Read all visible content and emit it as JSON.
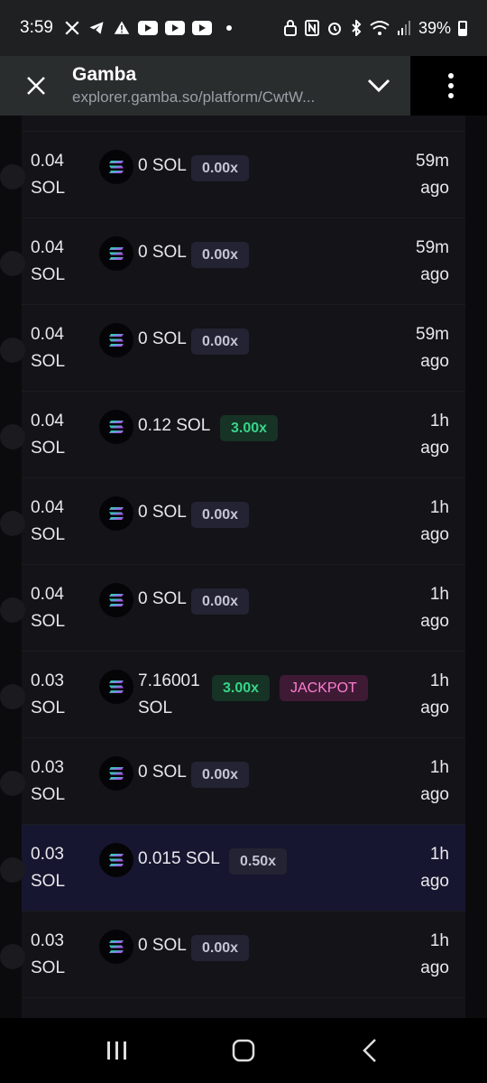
{
  "status_bar": {
    "time": "3:59",
    "battery": "39%",
    "left_icons": [
      "x-icon",
      "telegram-icon",
      "warning-icon",
      "youtube-icon",
      "youtube-icon",
      "youtube-icon"
    ],
    "right_icons": [
      "lock-icon",
      "nfc-icon",
      "alarm-icon",
      "bluetooth-icon",
      "wifi-icon",
      "signal-icon"
    ]
  },
  "header": {
    "title": "Gamba",
    "url": "explorer.gamba.so/platform/CwtW..."
  },
  "colors": {
    "win_badge": "#38d48a",
    "jackpot_badge": "#ff7fd0",
    "neutral_badge": "#c4c4d4",
    "highlight_row": "#161630"
  },
  "rows": [
    {
      "wager": "0.04",
      "wager_unit": "SOL",
      "payout": "0 SOL",
      "multiplier": "0.00x",
      "badge_type": "neutral",
      "time": "59m",
      "time_suffix": "ago"
    },
    {
      "wager": "0.04",
      "wager_unit": "SOL",
      "payout": "0 SOL",
      "multiplier": "0.00x",
      "badge_type": "neutral",
      "time": "59m",
      "time_suffix": "ago"
    },
    {
      "wager": "0.04",
      "wager_unit": "SOL",
      "payout": "0 SOL",
      "multiplier": "0.00x",
      "badge_type": "neutral",
      "time": "59m",
      "time_suffix": "ago"
    },
    {
      "wager": "0.04",
      "wager_unit": "SOL",
      "payout": "0.12 SOL",
      "multiplier": "3.00x",
      "badge_type": "win",
      "time": "1h",
      "time_suffix": "ago"
    },
    {
      "wager": "0.04",
      "wager_unit": "SOL",
      "payout": "0 SOL",
      "multiplier": "0.00x",
      "badge_type": "neutral",
      "time": "1h",
      "time_suffix": "ago"
    },
    {
      "wager": "0.04",
      "wager_unit": "SOL",
      "payout": "0 SOL",
      "multiplier": "0.00x",
      "badge_type": "neutral",
      "time": "1h",
      "time_suffix": "ago"
    },
    {
      "wager": "0.03",
      "wager_unit": "SOL",
      "payout": "7.16001",
      "payout_unit": "SOL",
      "multiplier": "3.00x",
      "badge_type": "win",
      "jackpot": "JACKPOT",
      "time": "1h",
      "time_suffix": "ago"
    },
    {
      "wager": "0.03",
      "wager_unit": "SOL",
      "payout": "0 SOL",
      "multiplier": "0.00x",
      "badge_type": "neutral",
      "time": "1h",
      "time_suffix": "ago"
    },
    {
      "wager": "0.03",
      "wager_unit": "SOL",
      "payout": "0.015 SOL",
      "multiplier": "0.50x",
      "badge_type": "neutral",
      "time": "1h",
      "time_suffix": "ago",
      "highlighted": true
    },
    {
      "wager": "0.03",
      "wager_unit": "SOL",
      "payout": "0 SOL",
      "multiplier": "0.00x",
      "badge_type": "neutral",
      "time": "1h",
      "time_suffix": "ago"
    }
  ]
}
